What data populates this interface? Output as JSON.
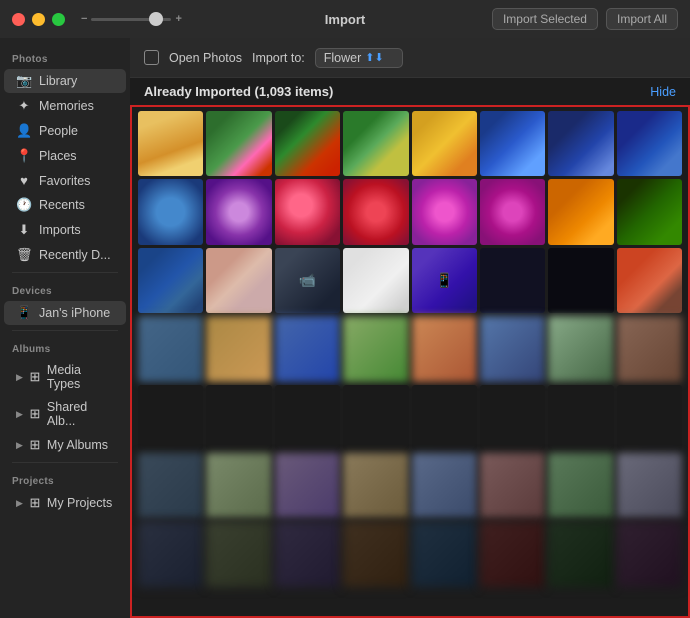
{
  "titlebar": {
    "title": "Import",
    "import_selected_label": "Import Selected",
    "import_all_label": "Import All"
  },
  "import_toolbar": {
    "open_photos_label": "Open Photos",
    "import_to_label": "Import to:",
    "album_name": "Flower",
    "checkbox_checked": false
  },
  "already_imported": {
    "text": "Already Imported (1,093 items)",
    "hide_label": "Hide"
  },
  "sidebar": {
    "photos_section": "Photos",
    "devices_section": "Devices",
    "albums_section": "Albums",
    "projects_section": "Projects",
    "items": [
      {
        "id": "library",
        "label": "Library",
        "icon": "📷"
      },
      {
        "id": "memories",
        "label": "Memories",
        "icon": "✨"
      },
      {
        "id": "people",
        "label": "People",
        "icon": "👤"
      },
      {
        "id": "places",
        "label": "Places",
        "icon": "📍"
      },
      {
        "id": "favorites",
        "label": "Favorites",
        "icon": "♥"
      },
      {
        "id": "recents",
        "label": "Recents",
        "icon": "🕐"
      },
      {
        "id": "imports",
        "label": "Imports",
        "icon": "↓"
      },
      {
        "id": "recently-deleted",
        "label": "Recently D...",
        "icon": "🗑"
      }
    ],
    "devices": [
      {
        "id": "jans-iphone",
        "label": "Jan's iPhone",
        "icon": "📱"
      }
    ],
    "albums": [
      {
        "id": "media-types",
        "label": "Media Types",
        "icon": "▶"
      },
      {
        "id": "shared-albums",
        "label": "Shared Alb...",
        "icon": "▶"
      },
      {
        "id": "my-albums",
        "label": "My Albums",
        "icon": "▶"
      }
    ],
    "projects": [
      {
        "id": "my-projects",
        "label": "My Projects",
        "icon": "▶"
      }
    ]
  },
  "zoom": {
    "minus": "−",
    "plus": "+"
  }
}
